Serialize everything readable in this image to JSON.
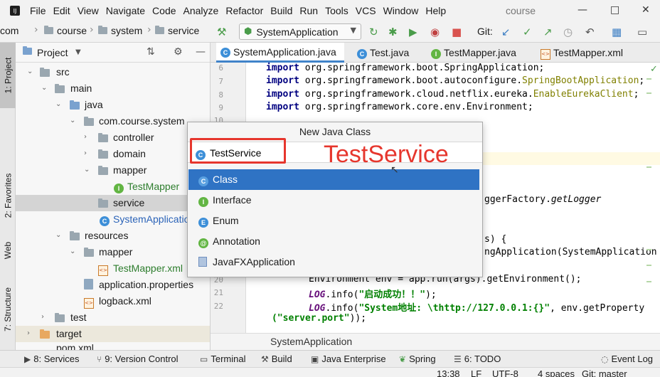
{
  "menubar": {
    "items": [
      "File",
      "Edit",
      "View",
      "Navigate",
      "Code",
      "Analyze",
      "Refactor",
      "Build",
      "Run",
      "Tools",
      "VCS",
      "Window",
      "Help"
    ],
    "project_title": "course",
    "minimize": "—",
    "maximize": "□",
    "close": "✕"
  },
  "navbar": {
    "crumbs": [
      "com",
      "course",
      "system",
      "service"
    ],
    "run_config": "SystemApplication",
    "git_label": "Git:"
  },
  "left_strip": {
    "tabs": [
      "1: Project",
      "2: Favorites",
      "Web",
      "7: Structure"
    ]
  },
  "project_panel": {
    "header": "Project",
    "tree": [
      {
        "label": "src"
      },
      {
        "label": "main"
      },
      {
        "label": "java"
      },
      {
        "label": "com.course.system"
      },
      {
        "label": "controller"
      },
      {
        "label": "domain"
      },
      {
        "label": "mapper"
      },
      {
        "label": "TestMapper"
      },
      {
        "label": "service"
      },
      {
        "label": "SystemApplication"
      },
      {
        "label": "resources"
      },
      {
        "label": "mapper"
      },
      {
        "label": "TestMapper.xml"
      },
      {
        "label": "application.properties"
      },
      {
        "label": "logback.xml"
      },
      {
        "label": "test"
      },
      {
        "label": "target"
      },
      {
        "label": "pom.xml"
      }
    ]
  },
  "editor_tabs": [
    "SystemApplication.java",
    "Test.java",
    "TestMapper.java",
    "TestMapper.xml"
  ],
  "editor": {
    "line_numbers": [
      "6",
      "7",
      "8",
      "9",
      "10",
      "20",
      "21",
      "22"
    ],
    "lines": {
      "l6_kw": "import",
      "l6_rest": " org.springframework.boot.SpringApplication;",
      "l7_kw": "import",
      "l7_pkg": " org.springframework.boot.autoconfigure.",
      "l7_ann": "SpringBootApplication",
      "l7_end": ";",
      "l8_kw": "import",
      "l8_pkg": " org.springframework.cloud.netflix.eureka.",
      "l8_ann": "EnableEurekaClient",
      "l8_end": ";",
      "l9_kw": "import",
      "l9_rest": " org.springframework.core.env.Environment;",
      "frag_logger_a": "ggerFactory.",
      "frag_logger_b": "getLogger",
      "frag_args": "s) {",
      "frag_spring": "ngApplication(SystemApplication",
      "l20": "Environment env = app.run(args).getEnvironment();",
      "l21_field": "LOG",
      "l21_rest": ".info(",
      "l21_str": "\"启动成功！！\"",
      "l21_end": ");",
      "l22_field": "LOG",
      "l22_rest": ".info(",
      "l22_str": "\"System地址: \\thttp://127.0.0.1:{}\"",
      "l22_end": ", env.getProperty",
      "l22b_str": "(\"server.port\"",
      "l22b_end": "));"
    },
    "bottom_breadcrumb": "SystemApplication"
  },
  "dialog": {
    "title": "New Java Class",
    "name_value": "TestService",
    "kinds": [
      "Class",
      "Interface",
      "Enum",
      "Annotation",
      "JavaFXApplication"
    ],
    "selected_kind": "Class"
  },
  "overlay": {
    "text": "TestService",
    "color": "#e6362d"
  },
  "bottom_tools": [
    "8: Services",
    "9: Version Control",
    "Terminal",
    "Build",
    "Java Enterprise",
    "Spring",
    "6: TODO",
    "Event Log"
  ],
  "status_bar": {
    "position": "13:38",
    "line_sep": "LF",
    "encoding": "UTF-8",
    "indent": "4 spaces",
    "git_branch": "Git: master"
  },
  "colors": {
    "selection": "#2f73c4",
    "highlight_red": "#e6362d",
    "keyword": "#000080"
  }
}
